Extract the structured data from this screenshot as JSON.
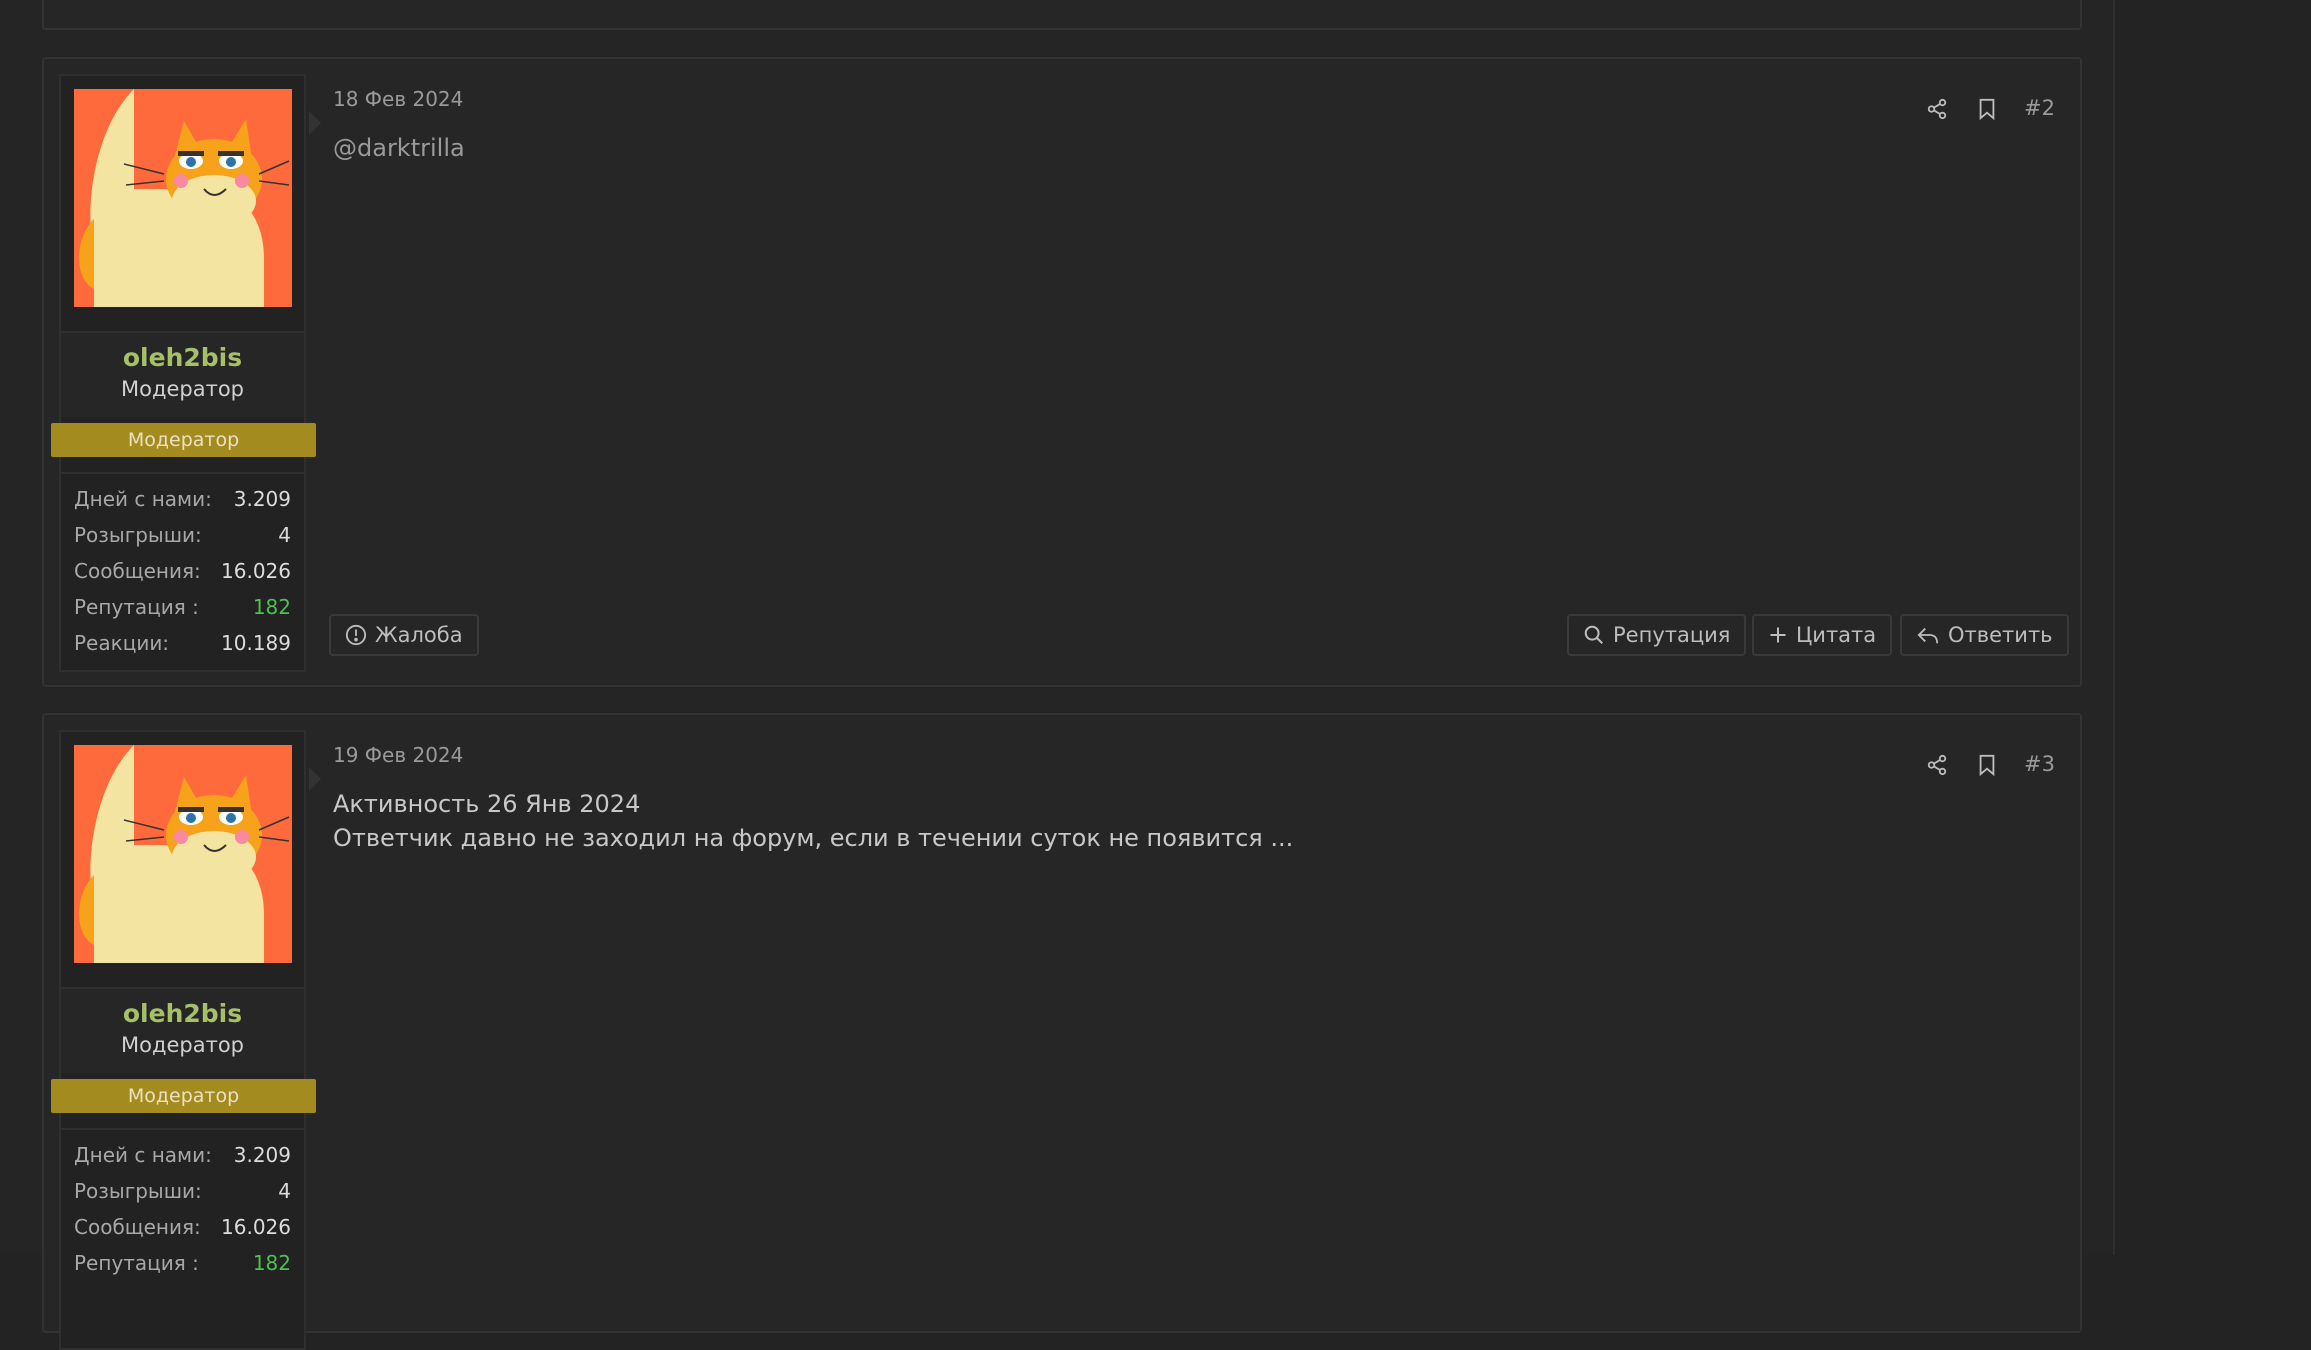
{
  "posts": [
    {
      "number": "#2",
      "date": "18 Фев 2024",
      "mention": "@darktrilla",
      "lines": [],
      "user": {
        "name": "oleh2bis",
        "title": "Модератор",
        "banner": "Модератор",
        "stats": [
          {
            "label": "Дней с нами:",
            "value": "3.209"
          },
          {
            "label": "Розыгрыши:",
            "value": "4"
          },
          {
            "label": "Сообщения:",
            "value": "16.026"
          },
          {
            "label": "Репутация :",
            "value": "182"
          },
          {
            "label": "Реакции:",
            "value": "10.189"
          }
        ]
      },
      "buttons": {
        "report": "Жалоба",
        "reputation": "Репутация",
        "quote": "Цитата",
        "reply": "Ответить"
      }
    },
    {
      "number": "#3",
      "date": "19 Фев 2024",
      "lines": [
        "Активность 26 Янв 2024",
        "Ответчик давно не заходил на форум, если в течении суток не появится ..."
      ],
      "user": {
        "name": "oleh2bis",
        "title": "Модератор",
        "banner": "Модератор",
        "stats": [
          {
            "label": "Дней с нами:",
            "value": "3.209"
          },
          {
            "label": "Розыгрыши:",
            "value": "4"
          },
          {
            "label": "Сообщения:",
            "value": "16.026"
          },
          {
            "label": "Репутация :",
            "value": "182"
          }
        ]
      }
    }
  ],
  "colors": {
    "username": "#a6c06a",
    "banner": "#a48b20",
    "reputation": "#4cc14c",
    "avatar_bg": "#ff6a3d"
  },
  "icons": [
    "share-icon",
    "bookmark-icon",
    "report-icon",
    "search-icon",
    "plus-icon",
    "reply-icon"
  ]
}
